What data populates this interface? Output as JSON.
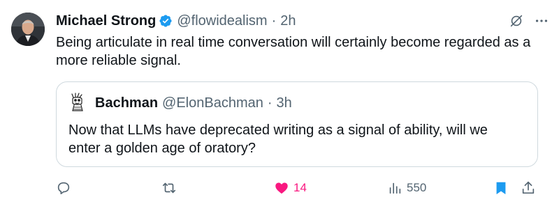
{
  "tweet": {
    "author_name": "Michael Strong",
    "handle": "@flowidealism",
    "separator": "·",
    "time": "2h",
    "text": "Being articulate in real time conversation will certainly become regarded as a more reliable signal."
  },
  "quote": {
    "author_name": "Bachman",
    "handle": "@ElonBachman",
    "separator": "·",
    "time": "3h",
    "text": "Now that LLMs have deprecated writing as a signal of ability, will we enter a golden age of oratory?"
  },
  "actions": {
    "likes": "14",
    "views": "550"
  },
  "colors": {
    "verified": "#1d9bf0",
    "like": "#f91880",
    "bookmark": "#1d9bf0",
    "muted": "#536471"
  }
}
